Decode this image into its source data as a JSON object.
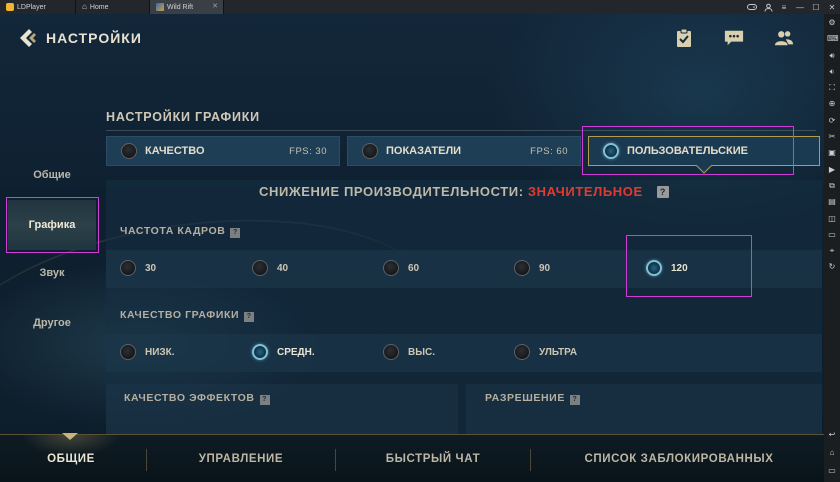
{
  "emulator": {
    "tabs": [
      {
        "label": "LDPlayer",
        "icon": "ldplayer-logo-icon"
      },
      {
        "label": "Home",
        "icon": "home-icon"
      },
      {
        "label": "Wild Rift",
        "icon": "wild-rift-icon"
      }
    ]
  },
  "header": {
    "title": "НАСТРОЙКИ",
    "icons": [
      "clipboard-check-icon",
      "chat-icon",
      "friends-icon"
    ]
  },
  "categories": [
    {
      "label": "Общие",
      "active": false
    },
    {
      "label": "Графика",
      "active": true
    },
    {
      "label": "Звук",
      "active": false
    },
    {
      "label": "Другое",
      "active": false
    }
  ],
  "graphics": {
    "section_title": "НАСТРОЙКИ ГРАФИКИ",
    "presets": [
      {
        "label": "КАЧЕСТВО",
        "fps": "FPS:  30",
        "selected": false
      },
      {
        "label": "ПОКАЗАТЕЛИ",
        "fps": "FPS:  60",
        "selected": false
      },
      {
        "label": "ПОЛЬЗОВАТЕЛЬСКИЕ",
        "fps": "",
        "selected": true
      }
    ],
    "perf_label": "СНИЖЕНИЕ ПРОИЗВОДИТЕЛЬНОСТИ:",
    "perf_level": "ЗНАЧИТЕЛЬНОЕ",
    "perf_level_color": "#e33a30",
    "framerate": {
      "title": "ЧАСТОТА КАДРОВ",
      "options": [
        "30",
        "40",
        "60",
        "90",
        "120"
      ],
      "selected": "120"
    },
    "quality": {
      "title": "КАЧЕСТВО ГРАФИКИ",
      "options": [
        "НИЗК.",
        "СРЕДН.",
        "ВЫС.",
        "УЛЬТРА"
      ],
      "selected": "СРЕДН."
    },
    "effects_title": "КАЧЕСТВО ЭФФЕКТОВ",
    "resolution_title": "РАЗРЕШЕНИЕ",
    "help_glyph": "?"
  },
  "bottom_tabs": [
    {
      "label": "ОБЩИЕ",
      "active": true
    },
    {
      "label": "УПРАВЛЕНИЕ",
      "active": false
    },
    {
      "label": "БЫСТРЫЙ ЧАТ",
      "active": false
    },
    {
      "label": "СПИСОК ЗАБЛОКИРОВАННЫХ",
      "active": false
    }
  ],
  "colors": {
    "accent_gold": "#c9b27a",
    "selected_radio": "#7fc2d8",
    "annotation": "#d13bd8"
  }
}
